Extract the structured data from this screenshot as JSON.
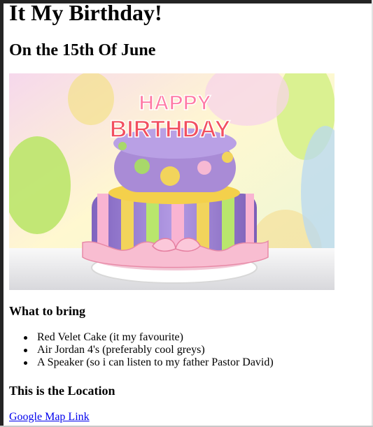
{
  "heading": "It My Birthday!",
  "date": "On the 15th Of June",
  "image": {
    "alt": "Birthday cake",
    "topper_text": [
      "HAPPY",
      "BIRTHDAY"
    ],
    "colors": {
      "purple": "#a98bd6",
      "pink": "#f5b7cd",
      "yellow": "#f4d04b",
      "green": "#bde86a",
      "white": "#f7f7f7"
    }
  },
  "what_to_bring": {
    "title": "What to bring",
    "items": [
      "Red Velet Cake (it my favourite)",
      "Air Jordan 4's (preferably cool greys)",
      "A Speaker (so i can listen to my father Pastor David)"
    ]
  },
  "location": {
    "title": "This is the Location",
    "link_text": "Google Map Link"
  }
}
